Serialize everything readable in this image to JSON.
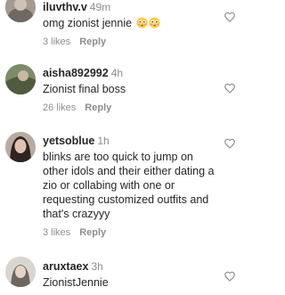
{
  "comments": [
    {
      "username": "iluvthv.v",
      "time": "49m",
      "text": "omg zionist jennie",
      "emojis": [
        "flushed-face-emoji",
        "flushed-face-emoji"
      ],
      "likes": "3 likes",
      "reply": "Reply"
    },
    {
      "username": "aisha892992",
      "time": "4h",
      "text": "Zionist final boss",
      "likes": "26 likes",
      "reply": "Reply"
    },
    {
      "username": "yetsoblue",
      "time": "1h",
      "text": "blinks are too quick to jump on other idols and their either dating a zio or collabing with one or requesting customized outfits and that's crazyyy",
      "likes": "3 likes",
      "reply": "Reply"
    },
    {
      "username": "aruxtaex",
      "time": "3h",
      "text": "ZionistJennie"
    }
  ],
  "colors": {
    "text": "#262626",
    "muted": "#8e8e8e",
    "background": "#ffffff"
  },
  "icons": {
    "like": "heart-outline-icon"
  }
}
